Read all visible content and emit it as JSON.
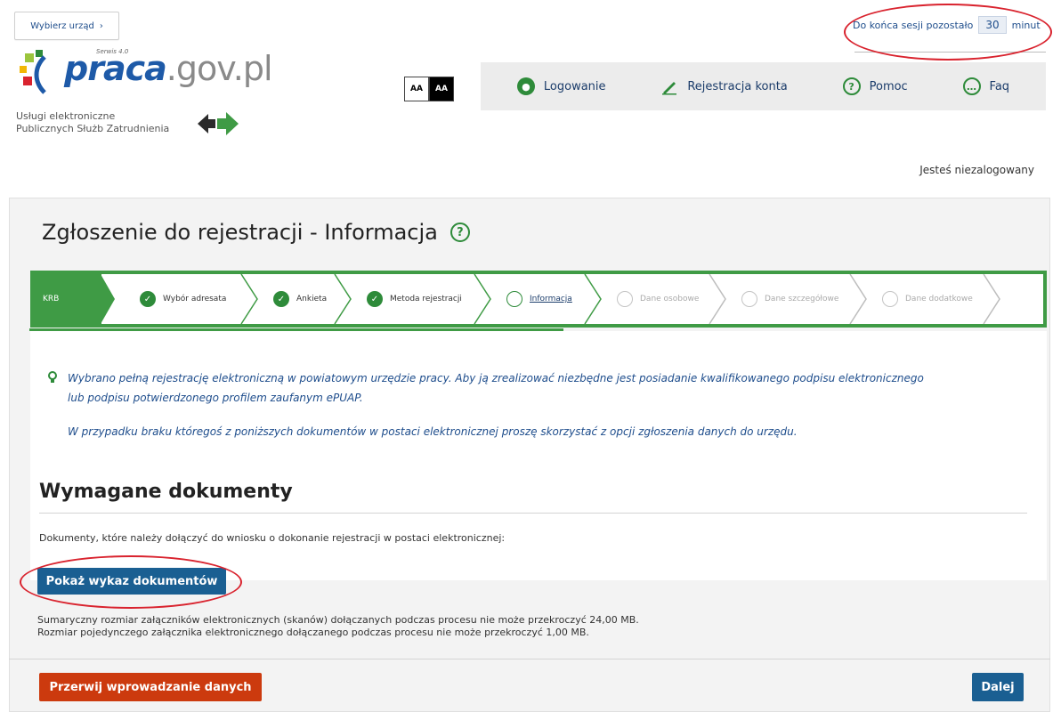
{
  "header": {
    "urzad_button": "Wybierz urząd",
    "urzad_chevron": "›",
    "logo_text_main": "praca",
    "logo_text_domain": ".gov.pl",
    "logo_super": "Serwis 4.0",
    "tagline_line1": "Usługi elektroniczne",
    "tagline_line2": "Publicznych Służb Zatrudnienia",
    "contrast_light": "AA",
    "contrast_dark": "AA",
    "session_label_before": "Do końca sesji pozostało",
    "session_minutes": "30",
    "session_label_after": "minut",
    "user_status": "Jesteś niezalogowany"
  },
  "topnav": {
    "items": [
      {
        "label": "Logowanie",
        "icon": "person-icon"
      },
      {
        "label": "Rejestracja konta",
        "icon": "pencil-icon"
      },
      {
        "label": "Pomoc",
        "icon": "question-icon"
      },
      {
        "label": "Faq",
        "icon": "chat-icon"
      }
    ]
  },
  "page": {
    "title": "Zgłoszenie do rejestracji - Informacja",
    "help_icon": "?"
  },
  "stepper": {
    "first": "KRB",
    "steps": [
      {
        "label": "Wybór adresata",
        "state": "done"
      },
      {
        "label": "Ankieta",
        "state": "done"
      },
      {
        "label": "Metoda rejestracji",
        "state": "done"
      },
      {
        "label": "Informacja",
        "state": "current"
      },
      {
        "label": "Dane osobowe",
        "state": "future"
      },
      {
        "label": "Dane szczegółowe",
        "state": "future"
      },
      {
        "label": "Dane dodatkowe",
        "state": "future"
      }
    ]
  },
  "info": {
    "line1": "Wybrano pełną rejestrację elektroniczną w powiatowym urzędzie pracy. Aby ją zrealizować niezbędne jest posiadanie kwalifikowanego podpisu elektronicznego lub podpisu potwierdzonego profilem zaufanym ePUAP.",
    "line2": "W przypadku braku któregoś z poniższych dokumentów w postaci elektronicznej proszę skorzystać z opcji zgłoszenia danych do urzędu."
  },
  "documents": {
    "title": "Wymagane dokumenty",
    "description": "Dokumenty, które należy dołączyć do wniosku o dokonanie rejestracji w postaci elektronicznej:",
    "show_button": "Pokaż wykaz dokumentów",
    "limit_total": "Sumaryczny rozmiar załączników elektronicznych (skanów) dołączanych podczas procesu nie może przekroczyć 24,00 MB.",
    "limit_single": "Rozmiar pojedynczego załącznika elektronicznego dołączanego podczas procesu nie może przekroczyć 1,00 MB."
  },
  "footer": {
    "cancel_button": "Przerwij wprowadzanie danych",
    "next_button": "Dalej"
  },
  "colors": {
    "accent_green": "#3f9b45",
    "primary_blue": "#1a5f92",
    "cancel_orange": "#cc3a0e",
    "highlight_red": "#d9232e"
  }
}
